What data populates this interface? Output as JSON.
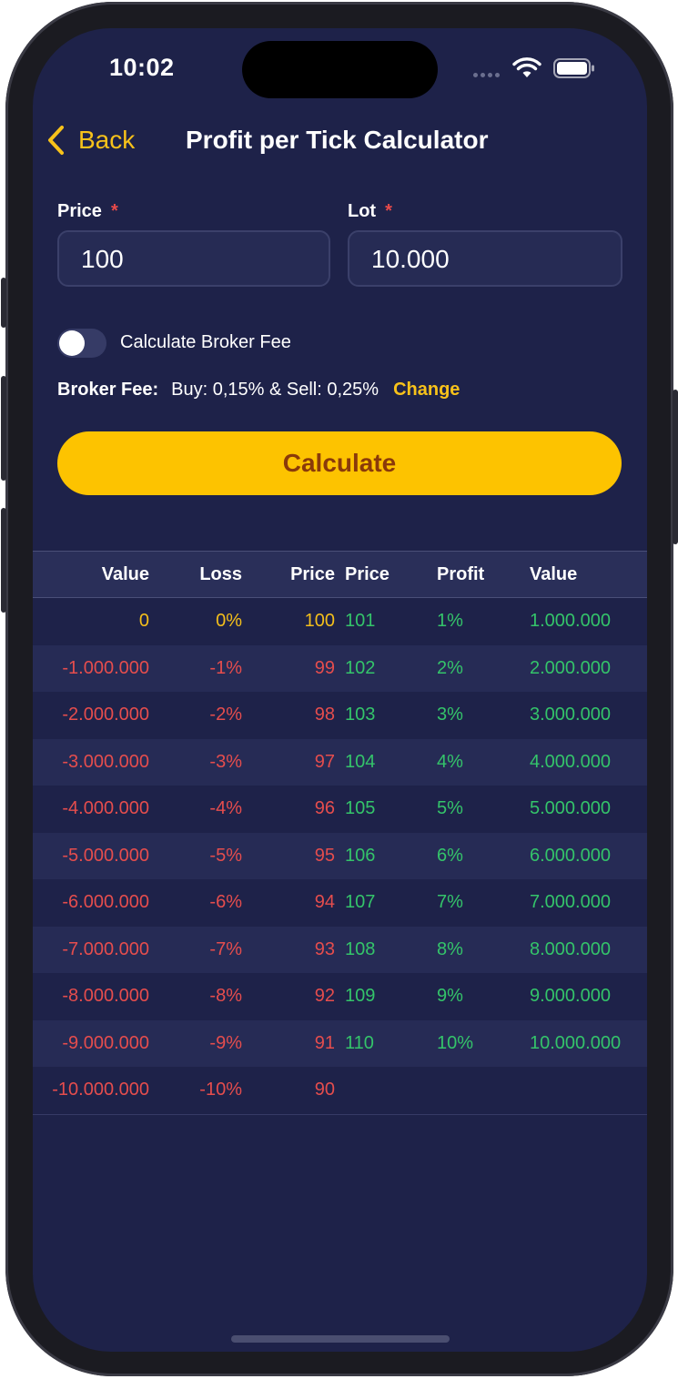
{
  "status": {
    "time": "10:02"
  },
  "nav": {
    "back_label": "Back",
    "title": "Profit per Tick Calculator"
  },
  "form": {
    "price_label": "Price",
    "lot_label": "Lot",
    "required_mark": "*",
    "price_value": "100",
    "lot_value": "10.000",
    "toggle_label": "Calculate Broker Fee",
    "toggle_on": false,
    "fee_label": "Broker Fee:",
    "fee_value": "Buy: 0,15% & Sell: 0,25%",
    "fee_change": "Change",
    "calculate_label": "Calculate"
  },
  "table": {
    "headers": [
      "Value",
      "Loss",
      "Price",
      "Price",
      "Profit",
      "Value"
    ],
    "rows": [
      {
        "loss_value": "0",
        "loss_pct": "0%",
        "loss_price": "100",
        "profit_price": "101",
        "profit_pct": "1%",
        "profit_value": "1.000.000",
        "neutral": true
      },
      {
        "loss_value": "-1.000.000",
        "loss_pct": "-1%",
        "loss_price": "99",
        "profit_price": "102",
        "profit_pct": "2%",
        "profit_value": "2.000.000"
      },
      {
        "loss_value": "-2.000.000",
        "loss_pct": "-2%",
        "loss_price": "98",
        "profit_price": "103",
        "profit_pct": "3%",
        "profit_value": "3.000.000"
      },
      {
        "loss_value": "-3.000.000",
        "loss_pct": "-3%",
        "loss_price": "97",
        "profit_price": "104",
        "profit_pct": "4%",
        "profit_value": "4.000.000"
      },
      {
        "loss_value": "-4.000.000",
        "loss_pct": "-4%",
        "loss_price": "96",
        "profit_price": "105",
        "profit_pct": "5%",
        "profit_value": "5.000.000"
      },
      {
        "loss_value": "-5.000.000",
        "loss_pct": "-5%",
        "loss_price": "95",
        "profit_price": "106",
        "profit_pct": "6%",
        "profit_value": "6.000.000"
      },
      {
        "loss_value": "-6.000.000",
        "loss_pct": "-6%",
        "loss_price": "94",
        "profit_price": "107",
        "profit_pct": "7%",
        "profit_value": "7.000.000"
      },
      {
        "loss_value": "-7.000.000",
        "loss_pct": "-7%",
        "loss_price": "93",
        "profit_price": "108",
        "profit_pct": "8%",
        "profit_value": "8.000.000"
      },
      {
        "loss_value": "-8.000.000",
        "loss_pct": "-8%",
        "loss_price": "92",
        "profit_price": "109",
        "profit_pct": "9%",
        "profit_value": "9.000.000"
      },
      {
        "loss_value": "-9.000.000",
        "loss_pct": "-9%",
        "loss_price": "91",
        "profit_price": "110",
        "profit_pct": "10%",
        "profit_value": "10.000.000"
      },
      {
        "loss_value": "-10.000.000",
        "loss_pct": "-10%",
        "loss_price": "90",
        "profit_price": "",
        "profit_pct": "",
        "profit_value": ""
      }
    ]
  },
  "colors": {
    "background": "#1e2249",
    "accent": "#fdc300",
    "loss": "#e54d4d",
    "profit": "#34c46a",
    "neutral": "#f4bf1b"
  },
  "icons": [
    "wifi-icon",
    "battery-icon",
    "chevron-left-icon"
  ]
}
